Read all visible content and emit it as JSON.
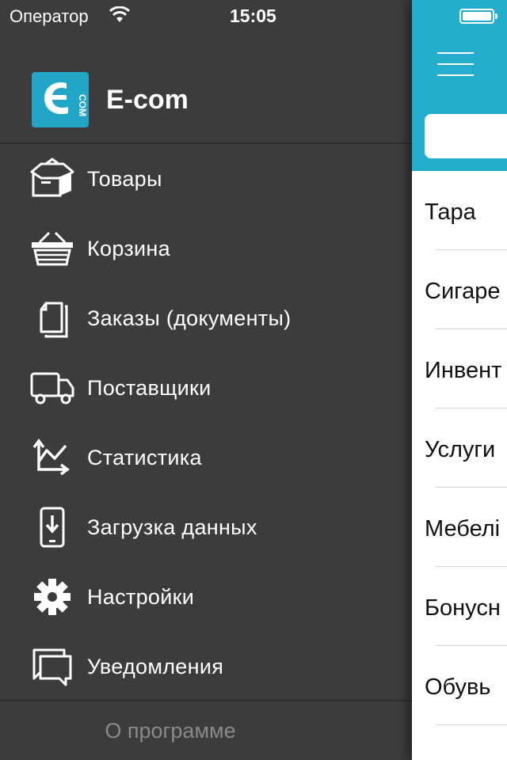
{
  "status_bar": {
    "carrier": "Оператор",
    "time": "15:05"
  },
  "brand": {
    "name": "E-com",
    "logo_text": "COM",
    "logo_color": "#21a6c8"
  },
  "menu": [
    {
      "label": "Товары",
      "icon": "goods-box-icon"
    },
    {
      "label": "Корзина",
      "icon": "basket-icon"
    },
    {
      "label": "Заказы (документы)",
      "icon": "documents-icon"
    },
    {
      "label": "Поставщики",
      "icon": "truck-icon"
    },
    {
      "label": "Статистика",
      "icon": "chart-icon"
    },
    {
      "label": "Загрузка данных",
      "icon": "phone-download-icon"
    },
    {
      "label": "Настройки",
      "icon": "gear-icon"
    },
    {
      "label": "Уведомления",
      "icon": "chat-icon"
    }
  ],
  "about": "О программе",
  "main": {
    "header_color": "#22aecc",
    "list": [
      "Тара",
      "Сигаре",
      "Инвент",
      "Услуги",
      "Мебелі",
      "Бонусн",
      "Обувь"
    ]
  }
}
